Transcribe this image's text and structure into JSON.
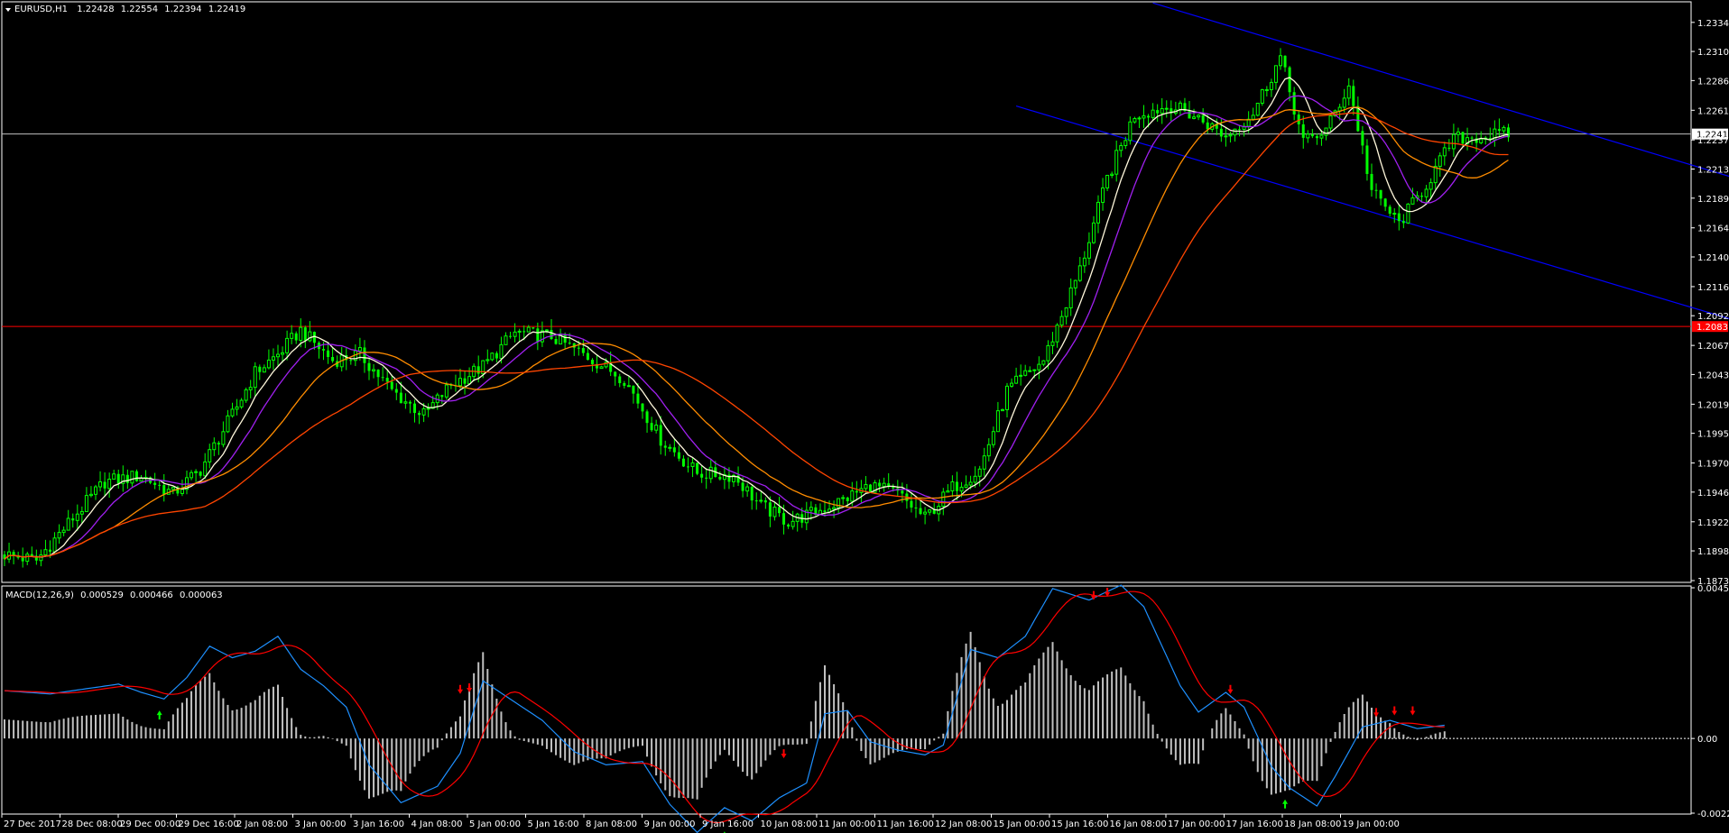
{
  "header": {
    "symbol": "EURUSD,H1",
    "open": "1.22428",
    "high": "1.22554",
    "low": "1.22394",
    "close": "1.22419"
  },
  "indicator": {
    "label": "MACD(12,26,9)",
    "v1": "0.000529",
    "v2": "0.000466",
    "v3": "0.000063"
  },
  "price_axis": {
    "ticks": [
      "1.23340",
      "1.23100",
      "1.22860",
      "1.22615",
      "1.22370",
      "1.22130",
      "1.21890",
      "1.21645",
      "1.21405",
      "1.21160",
      "1.20920",
      "1.20675",
      "1.20435",
      "1.20190",
      "1.19950",
      "1.19705",
      "1.19465",
      "1.19220",
      "1.18980",
      "1.18735"
    ],
    "current_price": "1.22419",
    "level_price": "1.20831"
  },
  "macd_axis": {
    "ticks": [
      "0.004572",
      "0.00",
      "-0.002266"
    ]
  },
  "time_axis": {
    "labels": [
      "27 Dec 2017",
      "28 Dec 08:00",
      "29 Dec 00:00",
      "29 Dec 16:00",
      "2 Jan 08:00",
      "3 Jan 00:00",
      "3 Jan 16:00",
      "4 Jan 08:00",
      "5 Jan 00:00",
      "5 Jan 16:00",
      "8 Jan 08:00",
      "9 Jan 00:00",
      "9 Jan 16:00",
      "10 Jan 08:00",
      "11 Jan 00:00",
      "11 Jan 16:00",
      "12 Jan 08:00",
      "15 Jan 00:00",
      "15 Jan 16:00",
      "16 Jan 08:00",
      "17 Jan 00:00",
      "17 Jan 16:00",
      "18 Jan 08:00",
      "19 Jan 00:00"
    ]
  },
  "colors": {
    "background": "#000000",
    "frame": "#ffffff",
    "candles": "#00ff00",
    "level_line": "#ff0000",
    "level_label_bg": "#ff0000",
    "current_line": "#c0c0c0",
    "channel": "#0000ff",
    "ma_fast": "#fff8dc",
    "ma_violet": "#a020f0",
    "ma_orange1": "#ff8c00",
    "ma_orange2": "#ff4500",
    "macd_main": "#1e90ff",
    "macd_signal": "#ff0000",
    "histogram": "#c0c0c0",
    "arrow_sell": "#ff0000",
    "arrow_buy": "#00ff00"
  },
  "chart_data": [
    {
      "type": "line",
      "panel": "price",
      "price_range": [
        1.18735,
        1.2348
      ],
      "x_range": [
        0,
        300
      ],
      "price_path": [
        [
          0,
          1.1895
        ],
        [
          7,
          1.189
        ],
        [
          15,
          1.1925
        ],
        [
          22,
          1.1955
        ],
        [
          30,
          1.196
        ],
        [
          37,
          1.1945
        ],
        [
          43,
          1.1965
        ],
        [
          50,
          1.201
        ],
        [
          55,
          1.2045
        ],
        [
          60,
          1.206
        ],
        [
          65,
          1.208
        ],
        [
          72,
          1.2055
        ],
        [
          78,
          1.206
        ],
        [
          85,
          1.203
        ],
        [
          92,
          1.201
        ],
        [
          98,
          1.2035
        ],
        [
          105,
          1.205
        ],
        [
          112,
          1.2078
        ],
        [
          120,
          1.2075
        ],
        [
          128,
          1.2058
        ],
        [
          136,
          1.204
        ],
        [
          144,
          1.199
        ],
        [
          152,
          1.1962
        ],
        [
          160,
          1.196
        ],
        [
          166,
          1.1935
        ],
        [
          172,
          1.1922
        ],
        [
          178,
          1.193
        ],
        [
          184,
          1.194
        ],
        [
          190,
          1.1952
        ],
        [
          196,
          1.1945
        ],
        [
          202,
          1.1925
        ],
        [
          208,
          1.195
        ],
        [
          214,
          1.1965
        ],
        [
          220,
          1.203
        ],
        [
          228,
          1.2055
        ],
        [
          236,
          1.213
        ],
        [
          242,
          1.2205
        ],
        [
          248,
          1.2258
        ],
        [
          256,
          1.2265
        ],
        [
          262,
          1.2255
        ],
        [
          268,
          1.224
        ],
        [
          274,
          1.226
        ],
        [
          280,
          1.2305
        ],
        [
          285,
          1.2235
        ],
        [
          290,
          1.2245
        ],
        [
          295,
          1.2282
        ],
        [
          300,
          1.2195
        ],
        [
          306,
          1.2168
        ],
        [
          312,
          1.22
        ],
        [
          318,
          1.2238
        ],
        [
          325,
          1.224
        ],
        [
          330,
          1.2242
        ]
      ],
      "moving_averages": [
        {
          "name": "fast",
          "color": "#fff8dc",
          "lag": 3
        },
        {
          "name": "violet",
          "color": "#a020f0",
          "lag": 6
        },
        {
          "name": "orange",
          "color": "#ff8c00",
          "lag": 12
        },
        {
          "name": "slow",
          "color": "#ff4500",
          "lag": 22
        }
      ],
      "horizontal_levels": [
        1.20831,
        1.22419
      ],
      "channel_lines": [
        {
          "from": [
            252,
            1.235
          ],
          "to": [
            420,
            1.216
          ]
        },
        {
          "from": [
            222,
            1.2265
          ],
          "to": [
            420,
            1.2043
          ]
        }
      ]
    },
    {
      "type": "bar",
      "panel": "macd",
      "ylim": [
        -0.002266,
        0.004572
      ],
      "main_path": [
        [
          0,
          0.00145
        ],
        [
          10,
          0.00135
        ],
        [
          20,
          0.00155
        ],
        [
          25,
          0.00165
        ],
        [
          30,
          0.0014
        ],
        [
          35,
          0.0012
        ],
        [
          40,
          0.00185
        ],
        [
          45,
          0.0028
        ],
        [
          50,
          0.00245
        ],
        [
          55,
          0.00265
        ],
        [
          60,
          0.0031
        ],
        [
          65,
          0.0021
        ],
        [
          70,
          0.0016
        ],
        [
          75,
          0.00095
        ],
        [
          80,
          -0.0008
        ],
        [
          87,
          -0.00195
        ],
        [
          95,
          -0.00145
        ],
        [
          100,
          -0.00045
        ],
        [
          105,
          0.00175
        ],
        [
          112,
          0.0011
        ],
        [
          118,
          0.00055
        ],
        [
          125,
          -0.0004
        ],
        [
          132,
          -0.0008
        ],
        [
          140,
          -0.0007
        ],
        [
          146,
          -0.002
        ],
        [
          152,
          -0.00285
        ],
        [
          158,
          -0.0021
        ],
        [
          164,
          -0.0025
        ],
        [
          170,
          -0.0018
        ],
        [
          176,
          -0.00135
        ],
        [
          180,
          0.00075
        ],
        [
          185,
          0.00085
        ],
        [
          190,
          -0.0001
        ],
        [
          196,
          -0.00035
        ],
        [
          202,
          -0.0005
        ],
        [
          206,
          -0.0002
        ],
        [
          212,
          0.0027
        ],
        [
          218,
          0.00245
        ],
        [
          224,
          0.0031
        ],
        [
          230,
          0.00455
        ],
        [
          238,
          0.0042
        ],
        [
          245,
          0.00465
        ],
        [
          250,
          0.004
        ],
        [
          258,
          0.0016
        ],
        [
          262,
          0.0008
        ],
        [
          268,
          0.0014
        ],
        [
          272,
          0.00095
        ],
        [
          278,
          -0.00085
        ],
        [
          282,
          -0.0015
        ],
        [
          288,
          -0.00205
        ],
        [
          292,
          -0.00115
        ],
        [
          298,
          0.00035
        ],
        [
          304,
          0.00055
        ],
        [
          310,
          0.0003
        ],
        [
          316,
          0.0004
        ]
      ],
      "signal_lag": 4,
      "histogram_scale": 0.4,
      "buy_arrows": [
        [
          34,
          0.00085
        ],
        [
          158,
          -0.00282
        ],
        [
          281,
          -0.00185
        ]
      ],
      "sell_arrows": [
        [
          100,
          0.00135
        ],
        [
          102,
          0.0014
        ],
        [
          171,
          -0.0006
        ],
        [
          239,
          0.0042
        ],
        [
          242,
          0.0043
        ],
        [
          269,
          0.00135
        ],
        [
          301,
          0.00065
        ],
        [
          305,
          0.0007
        ],
        [
          309,
          0.0007
        ]
      ]
    }
  ]
}
